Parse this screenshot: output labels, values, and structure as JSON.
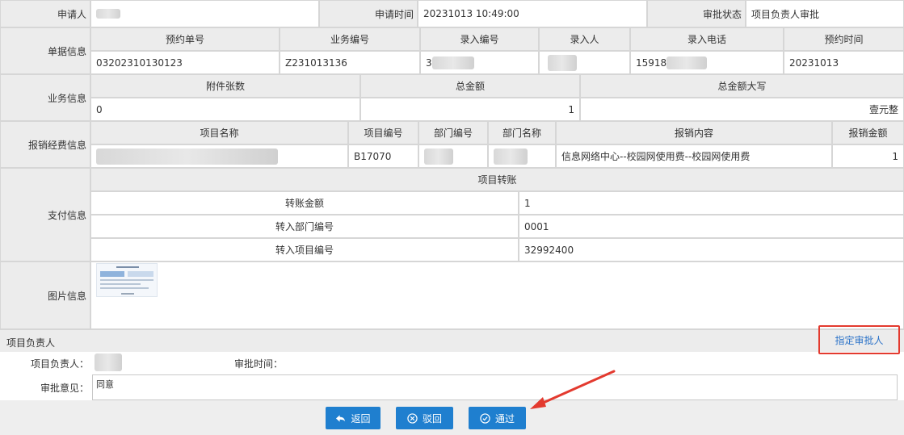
{
  "header": {
    "applicant_label": "申请人",
    "apply_time_label": "申请时间",
    "apply_time": "20231013 10:49:00",
    "status_label": "审批状态",
    "status": "项目负责人审批"
  },
  "doc_info": {
    "label": "单据信息",
    "columns": [
      "预约单号",
      "业务编号",
      "录入编号",
      "录入人",
      "录入电话",
      "预约时间"
    ],
    "values": [
      "03202310130123",
      "Z231013136",
      "3",
      "",
      "15918",
      "20231013"
    ]
  },
  "biz_info": {
    "label": "业务信息",
    "columns": [
      "附件张数",
      "总金额",
      "总金额大写"
    ],
    "values": [
      "0",
      "1",
      "壹元整"
    ]
  },
  "expense_info": {
    "label": "报销经费信息",
    "columns": [
      "项目名称",
      "项目编号",
      "部门编号",
      "部门名称",
      "报销内容",
      "报销金额"
    ],
    "values": [
      "",
      "B17070",
      "",
      "",
      "信息网络中心--校园网使用费--校园网使用费",
      "1"
    ]
  },
  "payment_info": {
    "label": "支付信息",
    "title": "项目转账",
    "rows": [
      {
        "label": "转账金额",
        "value": "1"
      },
      {
        "label": "转入部门编号",
        "value": "0001"
      },
      {
        "label": "转入项目编号",
        "value": "32992400"
      }
    ]
  },
  "image_info": {
    "label": "图片信息"
  },
  "approver_section": {
    "title": "项目负责人",
    "assign_link": "指定审批人",
    "leader_label": "项目负责人：",
    "approve_time_label": "审批时间：",
    "opinion_label": "审批意见：",
    "opinion_value": "同意"
  },
  "buttons": {
    "back": "返回",
    "reject": "驳回",
    "pass": "通过"
  },
  "colors": {
    "button_blue": "#1f7fcf",
    "highlight_red": "#e33a2f",
    "label_bg": "#ececec",
    "link_blue": "#2a72c8"
  }
}
